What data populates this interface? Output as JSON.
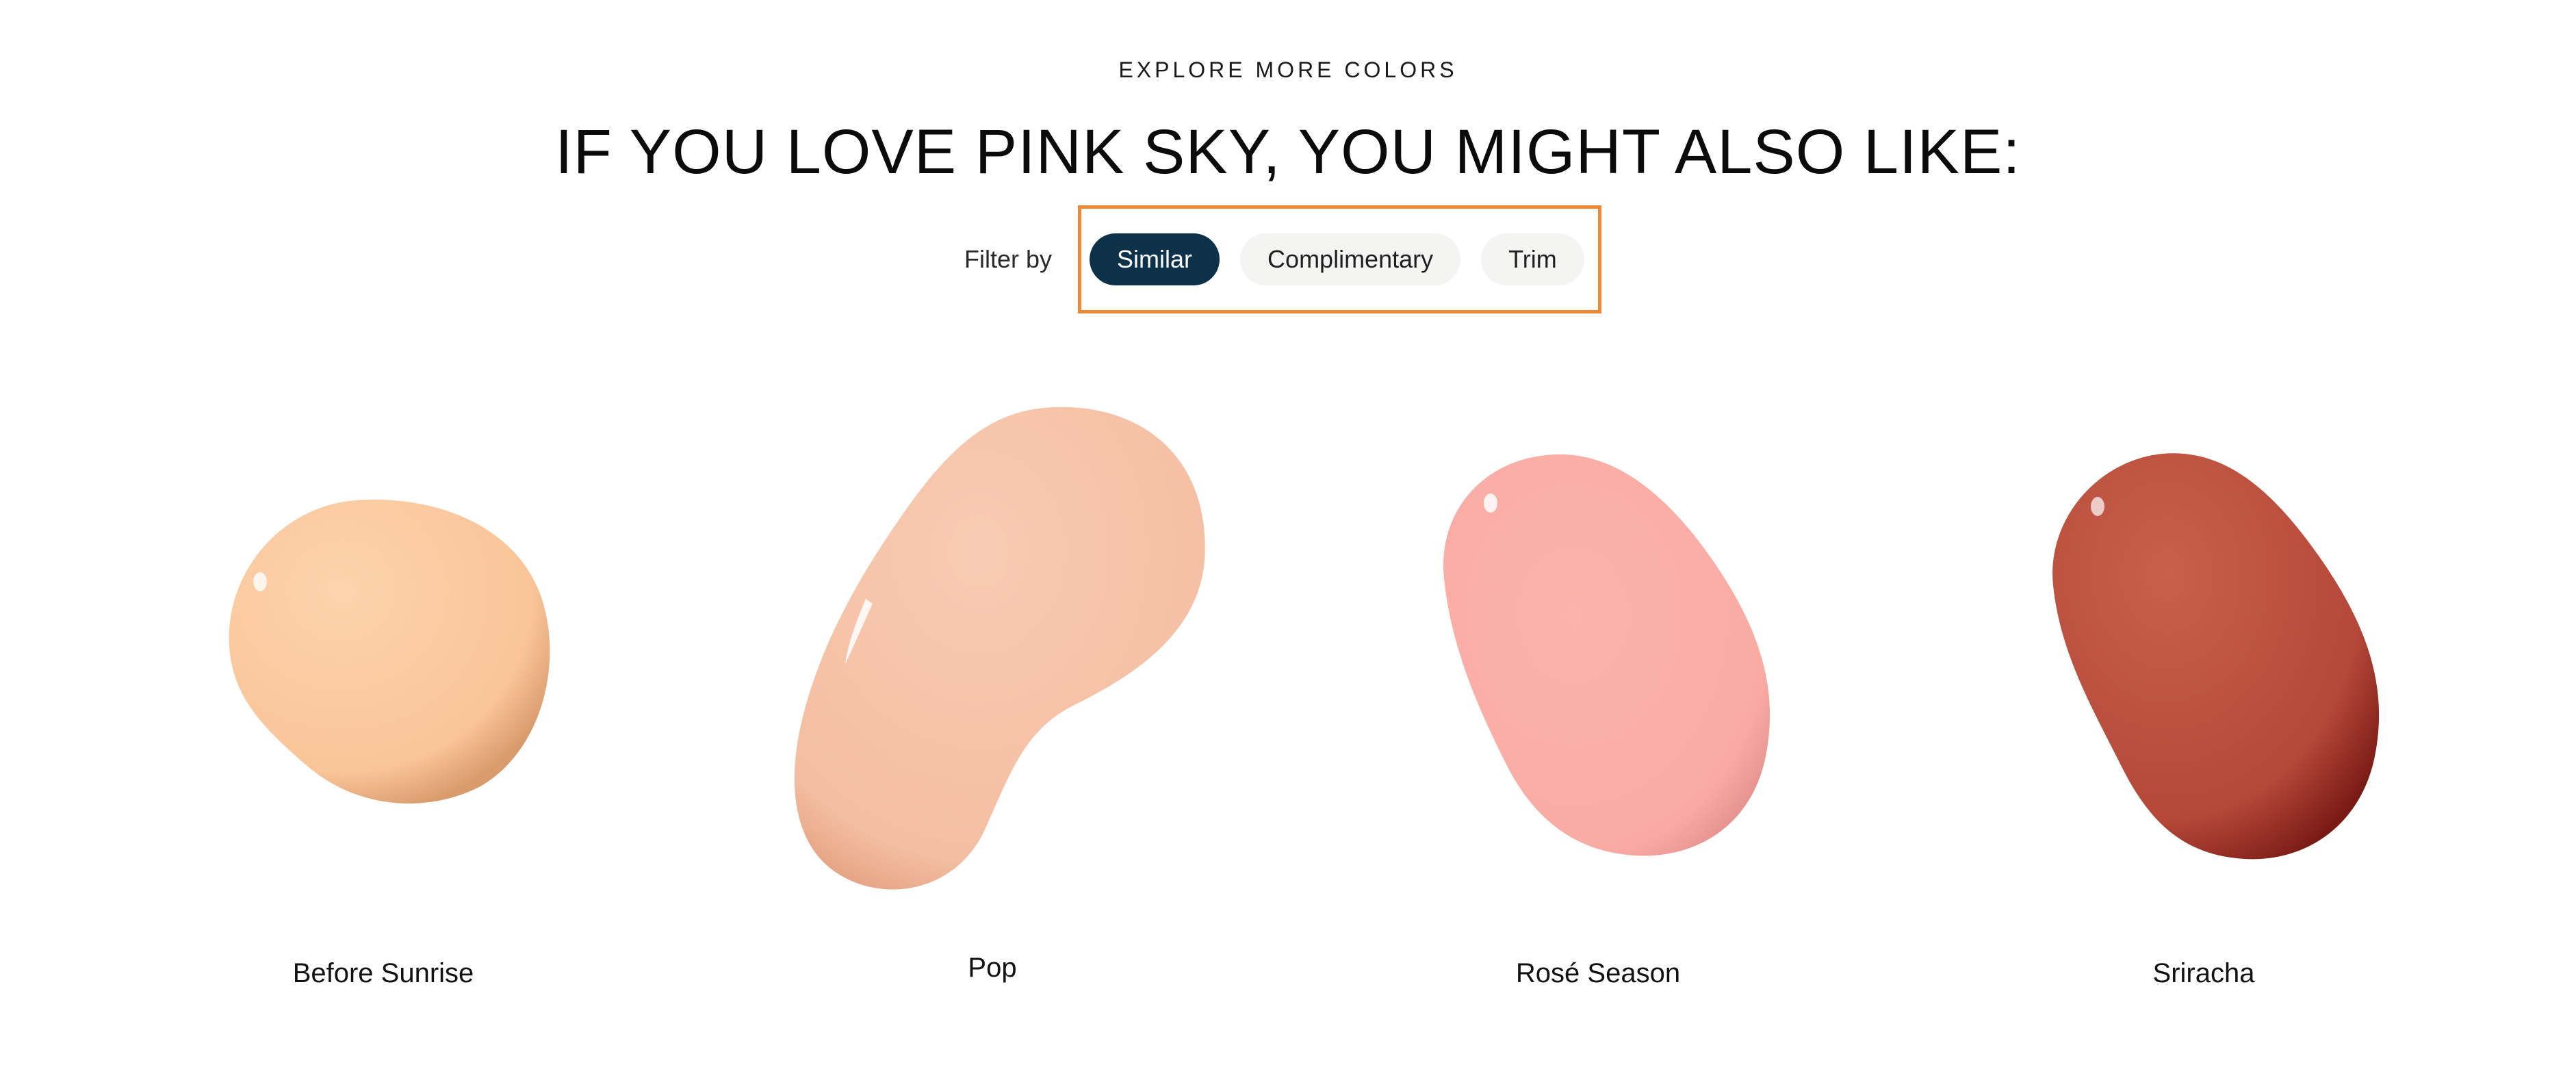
{
  "section": {
    "eyebrow": "EXPLORE MORE COLORS",
    "headline": "IF YOU LOVE PINK SKY, YOU MIGHT ALSO LIKE:"
  },
  "filter": {
    "label": "Filter by",
    "options": [
      {
        "label": "Similar",
        "active": true
      },
      {
        "label": "Complimentary",
        "active": false
      },
      {
        "label": "Trim",
        "active": false
      }
    ],
    "highlight_color": "#ee8a35",
    "active_color": "#0c3149"
  },
  "swatches": [
    {
      "name": "Before Sunrise",
      "color": "#fbc9a0"
    },
    {
      "name": "Pop",
      "color": "#f6c2a8"
    },
    {
      "name": "Rosé Season",
      "color": "#f9aba3"
    },
    {
      "name": "Sriracha",
      "color": "#b54839"
    }
  ]
}
